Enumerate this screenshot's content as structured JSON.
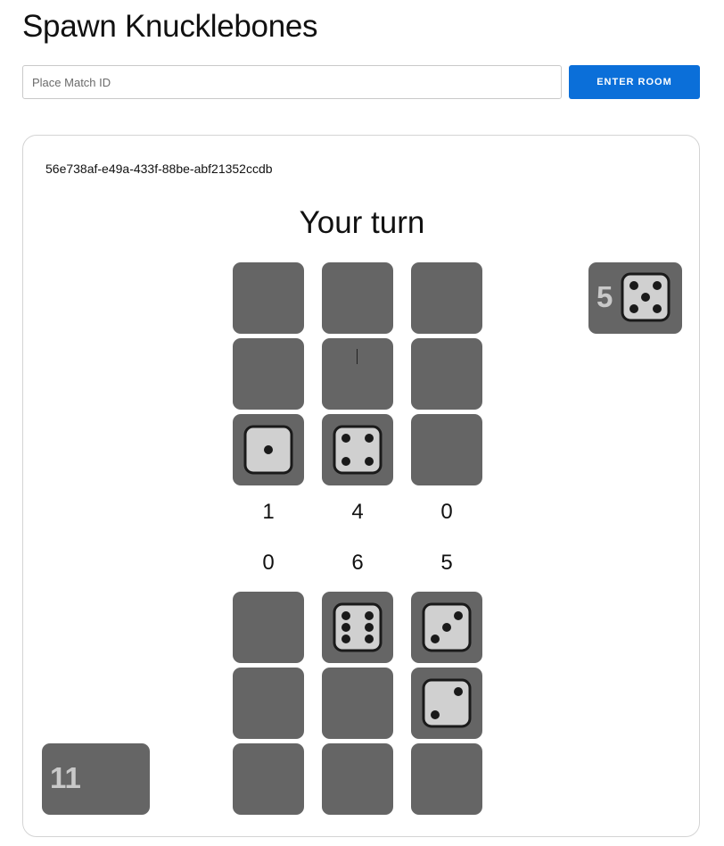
{
  "header": {
    "title": "Spawn Knucklebones"
  },
  "join": {
    "placeholder": "Place Match ID",
    "button_label": "ENTER ROOM"
  },
  "game": {
    "match_id": "56e738af-e49a-433f-88be-abf21352ccdb",
    "status": "Your turn",
    "current_die": {
      "value": "5",
      "face": 5
    },
    "player_total": "11",
    "opponent_board": [
      [
        0,
        0,
        0
      ],
      [
        0,
        0,
        0
      ],
      [
        1,
        4,
        0
      ]
    ],
    "opponent_scores": [
      "1",
      "4",
      "0"
    ],
    "player_scores": [
      "0",
      "6",
      "5"
    ],
    "player_board": [
      [
        0,
        6,
        3
      ],
      [
        0,
        0,
        2
      ],
      [
        0,
        0,
        0
      ]
    ]
  },
  "colors": {
    "accent": "#0b6fd9",
    "cell": "#656565",
    "die_face": "#d0d0d0",
    "pip": "#1a1a1a"
  },
  "icons": [
    "dice-face-icon"
  ]
}
